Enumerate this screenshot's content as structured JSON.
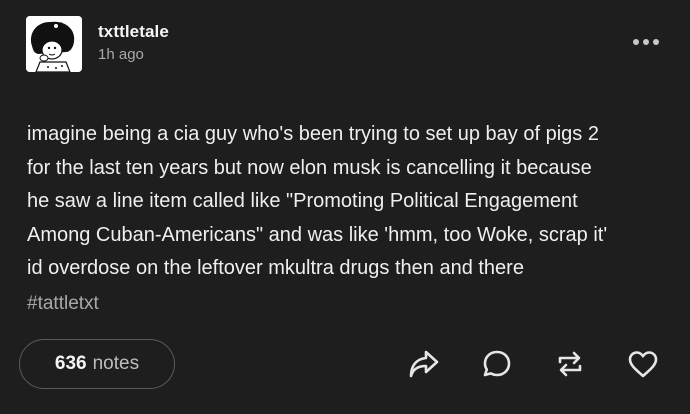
{
  "post": {
    "blog_name": "txttletale",
    "timestamp": "1h ago",
    "body_lines": [
      "imagine being a cia guy who's been trying to set up bay of pigs 2",
      "for the last ten years but now elon musk is cancelling it because",
      "he saw a line item called like \"Promoting Political Engagement",
      "Among Cuban-Americans\" and was like 'hmm, too Woke, scrap it'",
      "id overdose on the leftover mkultra drugs then and there"
    ],
    "tag": "#tattletxt",
    "notes_count": "636",
    "notes_label": "notes"
  },
  "icons": {
    "avatar": "avatar-cartoon-girl",
    "more": "more-dots-icon",
    "share": "share-arrow-icon",
    "reply": "reply-bubble-icon",
    "reblog": "reblog-icon",
    "like": "heart-icon"
  },
  "colors": {
    "background": "#1e1e1e",
    "text": "#efefef",
    "muted": "#a9a9a9",
    "border": "#5a5a5a"
  }
}
